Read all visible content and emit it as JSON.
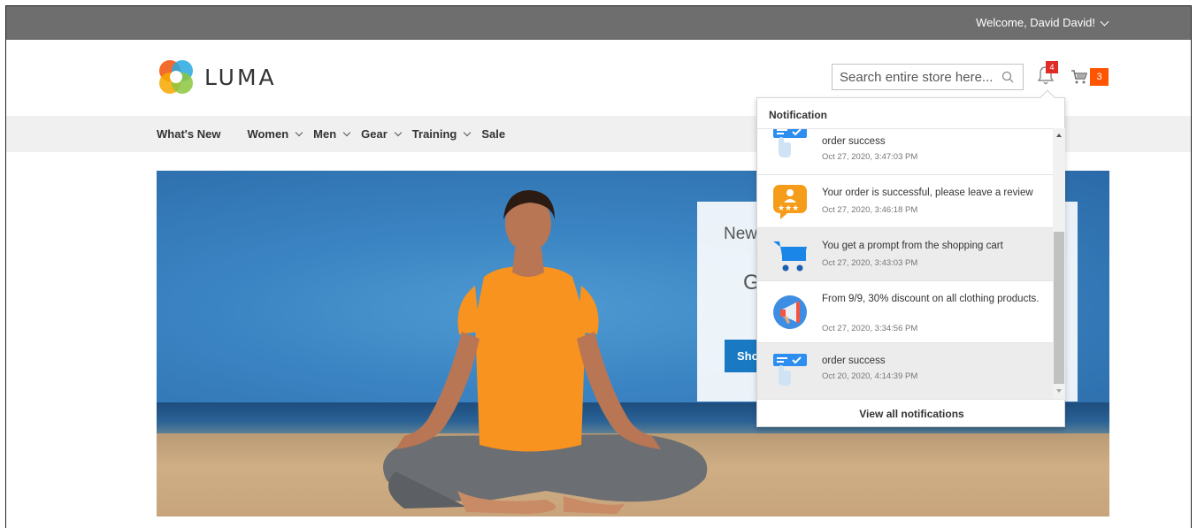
{
  "topbar": {
    "welcome": "Welcome, David David!"
  },
  "header": {
    "logo_text": "LUMA",
    "search_placeholder": "Search entire store here...",
    "notification_count": "4",
    "cart_count": "3"
  },
  "nav": {
    "items": [
      {
        "label": "What's New"
      },
      {
        "label": "Women"
      },
      {
        "label": "Men"
      },
      {
        "label": "Gear"
      },
      {
        "label": "Training"
      },
      {
        "label": "Sale"
      }
    ]
  },
  "hero": {
    "promo_title": "New",
    "promo_sub": "G",
    "promo_button": "Sho"
  },
  "notifications": {
    "title": "Notification",
    "items": [
      {
        "message": "order success",
        "time": "Oct 27, 2020, 3:47:03 PM",
        "icon": "order-icon"
      },
      {
        "message": "Your order is successful, please leave a review",
        "time": "Oct 27, 2020, 3:46:18 PM",
        "icon": "review-icon"
      },
      {
        "message": "You get a prompt from the shopping cart",
        "time": "Oct 27, 2020, 3:43:03 PM",
        "icon": "cart-icon"
      },
      {
        "message": "From 9/9, 30% discount on all clothing products.",
        "time": "Oct 27, 2020, 3:34:56 PM",
        "icon": "megaphone-icon"
      },
      {
        "message": "order success",
        "time": "Oct 20, 2020, 4:14:39 PM",
        "icon": "order-icon"
      }
    ],
    "view_all": "View all notifications"
  },
  "colors": {
    "topbar": "#6e6e6e",
    "badge_red": "#e02b27",
    "cart_badge": "#ff5501",
    "button_blue": "#1979c3"
  }
}
